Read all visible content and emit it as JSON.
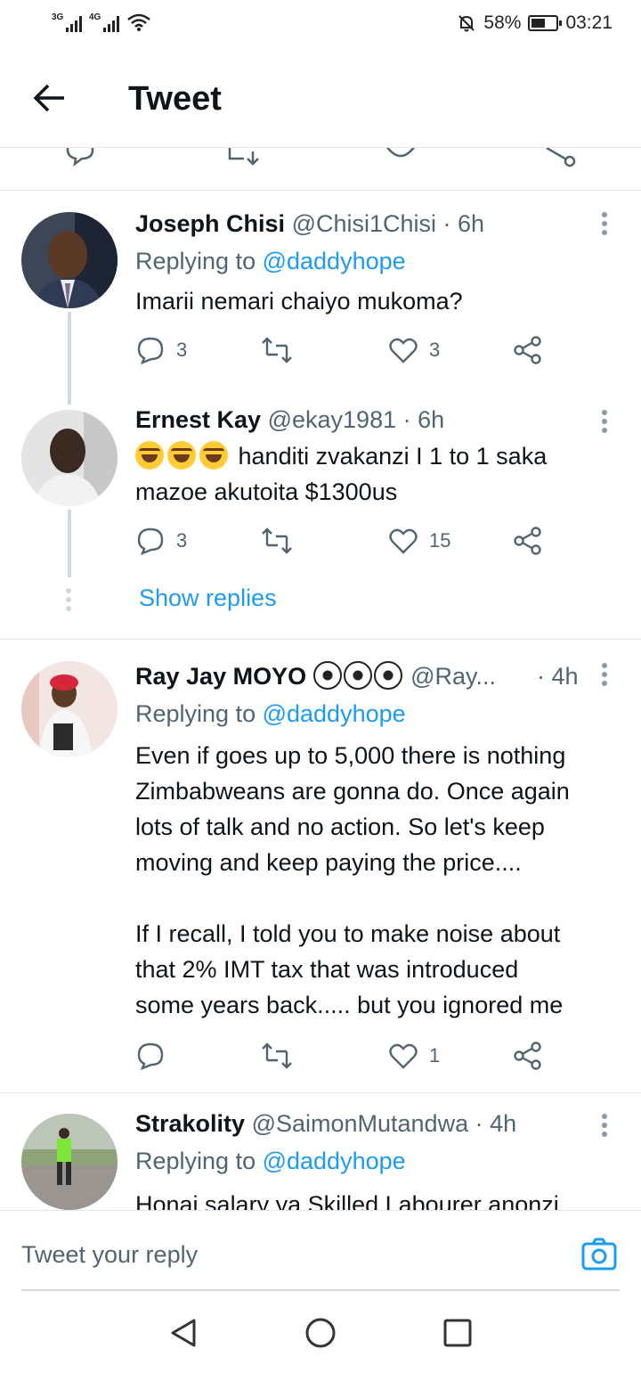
{
  "status_bar": {
    "network1": "3G",
    "network2": "4G",
    "battery": "58%",
    "time": "03:21"
  },
  "header": {
    "title": "Tweet"
  },
  "tweets": [
    {
      "name": "Joseph Chisi",
      "handle": "@Chisi1Chisi",
      "time": "· 6h",
      "replying_label": "Replying to ",
      "replying_to": "@daddyhope",
      "text": "Imarii nemari chaiyo mukoma?",
      "replies": "3",
      "retweets": "",
      "likes": "3"
    },
    {
      "name": "Ernest Kay",
      "handle": "@ekay1981",
      "time": "· 6h",
      "text_line1": "handiti zvakanzi I 1 to 1 saka",
      "text_line2": "mazoe akutoita $1300us",
      "replies": "3",
      "retweets": "",
      "likes": "15",
      "show_replies": "Show replies"
    },
    {
      "name": "Ray Jay MOYO",
      "handle": "@Ray...",
      "time": "· 4h",
      "replying_label": "Replying to ",
      "replying_to": "@daddyhope",
      "text_p1_l1": "Even if goes up to 5,000 there is nothing",
      "text_p1_l2": "Zimbabweans are gonna do. Once again",
      "text_p1_l3": "lots of talk and no action. So let's keep",
      "text_p1_l4": "moving and keep paying the price....",
      "text_p2_l1": "If I recall, I told you to make noise about",
      "text_p2_l2": "that  2% IMT tax that was introduced",
      "text_p2_l3": "some years back..... but you ignored me",
      "replies": "",
      "retweets": "",
      "likes": "1"
    },
    {
      "name": "Strakolity",
      "handle": "@SaimonMutandwa",
      "time": "· 4h",
      "replying_label": "Replying to ",
      "replying_to": "@daddyhope",
      "text": "Honai salary ya Skilled Labourer anonzi"
    }
  ],
  "reply_bar": {
    "placeholder": "Tweet your reply"
  },
  "icons": {
    "reply": "speech-bubble-icon",
    "retweet": "retweet-icon",
    "like": "heart-icon",
    "share": "share-icon",
    "more": "vertical-dots-icon"
  },
  "colors": {
    "accent": "#1d9bf0",
    "muted": "#536471",
    "text": "#0f1419"
  }
}
